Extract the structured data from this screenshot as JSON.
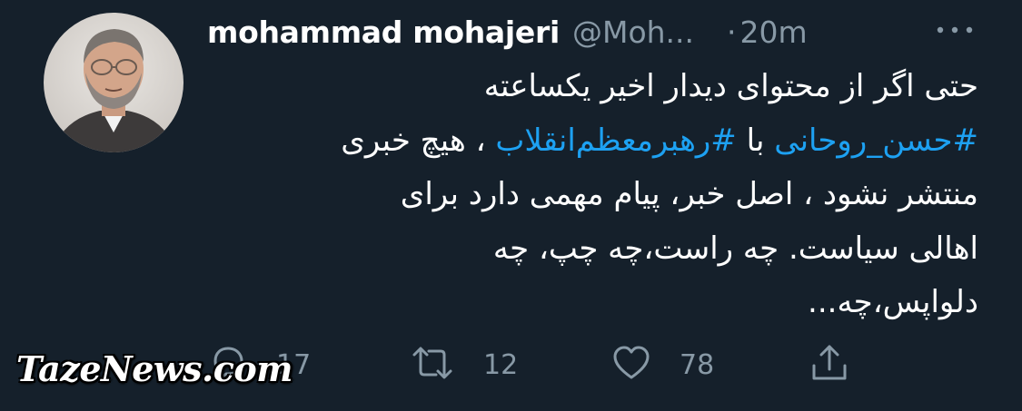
{
  "tweet": {
    "display_name": "mohammad mohajeri",
    "handle": "@Moh...",
    "separator": "·",
    "time": "20m",
    "more_icon": "more-dots-icon",
    "avatar_icon": "avatar",
    "body": {
      "line1": "حتی اگر از محتوای دیدار اخیر یکساعته",
      "line2_hashtag1": "#حسن_روحانی",
      "line2_mid": " با ",
      "line2_hashtag2": "#رهبرمعظم‌انقلاب",
      "line2_end": " ، هیچ خبری",
      "line3": "منتشر نشود ، اصل خبر، پیام مهمی دارد برای",
      "line4": "اهالی سیاست. چه راست،چه چپ، چه",
      "line5": "دلواپس،چه..."
    }
  },
  "actions": {
    "reply": {
      "icon": "reply-icon",
      "count": "17"
    },
    "retweet": {
      "icon": "retweet-icon",
      "count": "12"
    },
    "like": {
      "icon": "heart-icon",
      "count": "78"
    },
    "share": {
      "icon": "share-icon"
    }
  },
  "watermark": {
    "text": "TazeNews.com"
  },
  "colors": {
    "background": "#15202b",
    "text": "#ffffff",
    "muted": "#8899a6",
    "link": "#1da1f2"
  }
}
